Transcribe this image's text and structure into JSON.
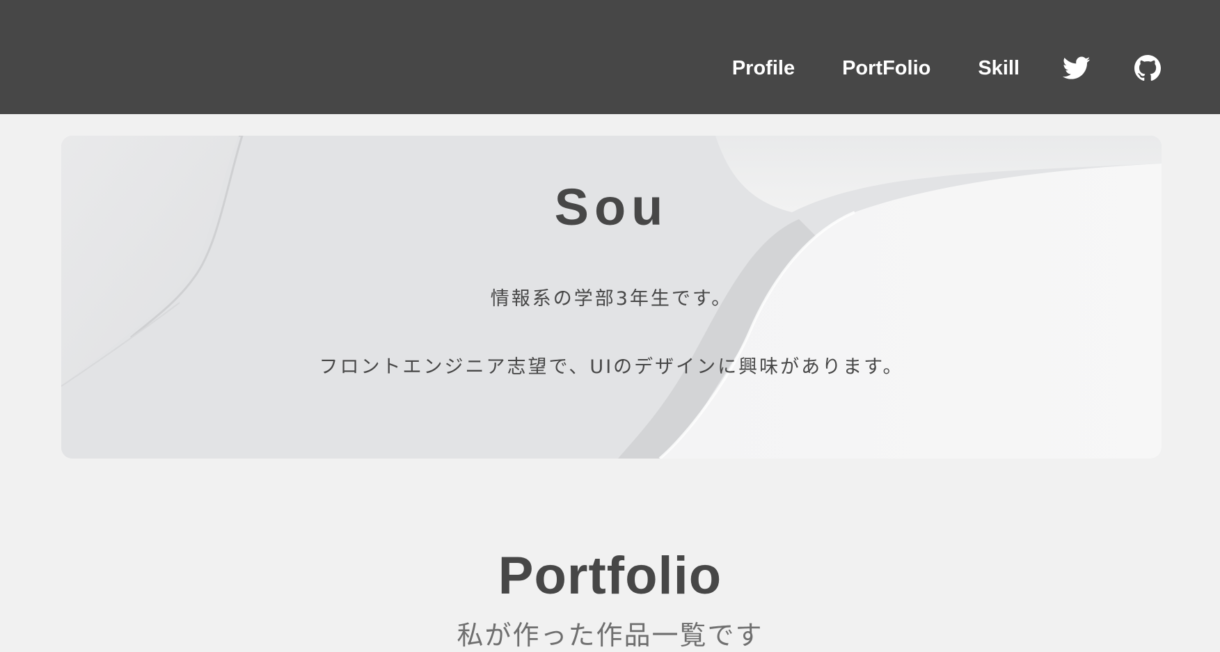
{
  "header": {
    "nav": [
      {
        "label": "Profile"
      },
      {
        "label": "PortFolio"
      },
      {
        "label": "Skill"
      }
    ],
    "icons": [
      "twitter-icon",
      "github-icon"
    ],
    "background_color": "#474747"
  },
  "hero": {
    "name": "Sou",
    "line1": "情報系の学部3年生です。",
    "line2": "フロントエンジニア志望で、UIのデザインに興味があります。"
  },
  "portfolio": {
    "title": "Portfolio",
    "subtitle": "私が作った作品一覧です"
  }
}
